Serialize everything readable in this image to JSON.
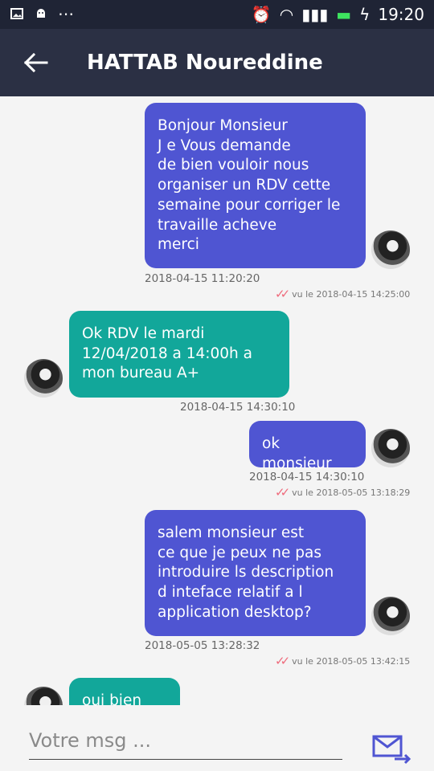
{
  "status": {
    "time": "19:20",
    "icons": [
      "image-icon",
      "android-icon",
      "more-icon",
      "alarm-icon",
      "wifi-icon",
      "signal-icon",
      "battery-icon",
      "charging-icon"
    ]
  },
  "header": {
    "title": "HATTAB Noureddine",
    "back_icon": "arrow-left-icon"
  },
  "messages": [
    {
      "type": "sent",
      "text": "Bonjour Monsieur\nJ e Vous demande\nde bien vouloir nous\norganiser un RDV cette\nsemaine pour corriger le\ntravaille acheve\nmerci",
      "time": "2018-04-15 11:20:20",
      "seen": "vu le 2018-04-15 14:25:00"
    },
    {
      "type": "received",
      "text": "Ok RDV le mardi\n12/04/2018 a 14:00h a\nmon bureau A+",
      "time": "2018-04-15 14:30:10"
    },
    {
      "type": "sent",
      "text": "ok monsieur",
      "time": "2018-04-15 14:30:10",
      "seen": "vu le 2018-05-05 13:18:29"
    },
    {
      "type": "sent",
      "text": "salem monsieur est\nce que je peux ne pas\nintroduire ls description\nd inteface relatif a l\napplication desktop?",
      "time": "2018-05-05 13:28:32",
      "seen": "vu le 2018-05-05 13:42:15"
    },
    {
      "type": "received",
      "text": "oui bien sur",
      "time": ""
    }
  ],
  "composer": {
    "placeholder": "Votre msg ...",
    "send_icon": "send-mail-icon"
  },
  "colors": {
    "sent": "#4f55d2",
    "received": "#12a79a",
    "toolbar": "#2b3044",
    "statusbar": "#1f2435"
  }
}
